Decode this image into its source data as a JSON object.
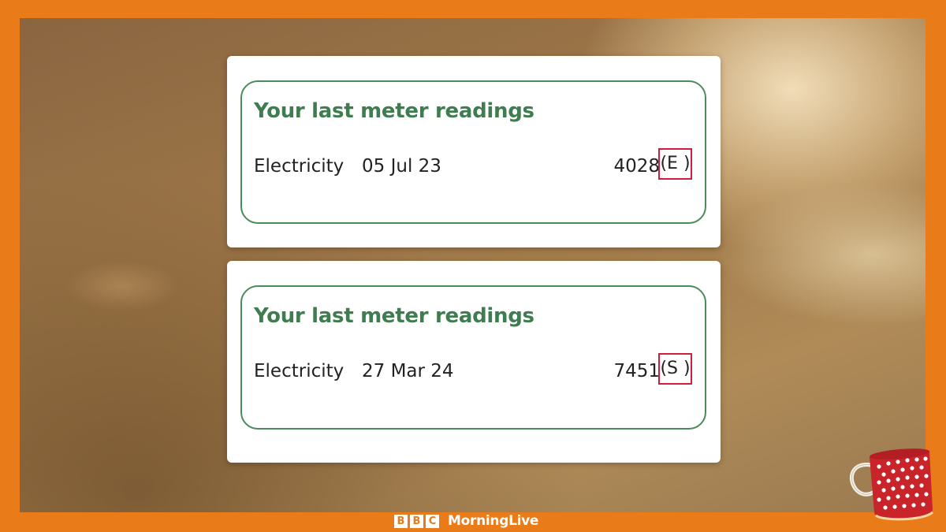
{
  "cards": [
    {
      "title": "Your last meter readings",
      "meter_type": "Electricity",
      "date": "05  Jul 23",
      "reading": "4028",
      "reading_type_flag": "(E )"
    },
    {
      "title": "Your last meter readings",
      "meter_type": "Electricity",
      "date": "27 Mar 24",
      "reading": "7451",
      "reading_type_flag": "(S )"
    }
  ],
  "branding": {
    "bbc_letters": [
      "B",
      "B",
      "C"
    ],
    "show_name": "MorningLive"
  },
  "colors": {
    "frame_orange": "#ea7b19",
    "title_green": "#3f7c4f",
    "panel_border_green": "#4b8a5b",
    "highlight_red": "#d01e3a"
  },
  "icons": {
    "mug": "polka-dot-mug-icon"
  }
}
